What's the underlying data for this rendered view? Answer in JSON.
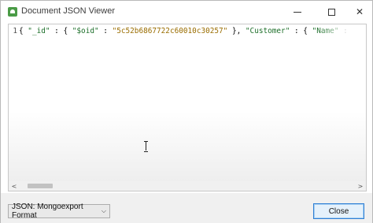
{
  "window": {
    "title": "Document JSON Viewer",
    "controls": {
      "minimize_icon": "minimize-icon",
      "maximize_icon": "maximize-icon",
      "close_glyph": "✕"
    }
  },
  "editor": {
    "line_number": "1",
    "tokens": [
      {
        "t": "{ ",
        "c": "punc"
      },
      {
        "t": "\"_id\"",
        "c": "key"
      },
      {
        "t": " : { ",
        "c": "punc"
      },
      {
        "t": "\"$oid\"",
        "c": "key"
      },
      {
        "t": " : ",
        "c": "punc"
      },
      {
        "t": "\"5c52b6867722c60010c30257\"",
        "c": "str"
      },
      {
        "t": " }, ",
        "c": "punc"
      },
      {
        "t": "\"Customer\"",
        "c": "key"
      },
      {
        "t": " : { ",
        "c": "punc"
      },
      {
        "t": "\"Name\"",
        "c": "key"
      },
      {
        "t": " : ",
        "c": "punc"
      },
      {
        "t": "\"",
        "c": "str"
      }
    ]
  },
  "scrollbar": {
    "left_arrow": "<",
    "right_arrow": ">"
  },
  "footer": {
    "format_selected": "JSON: Mongoexport Format",
    "format_chevron": "⌵",
    "close_label": "Close"
  }
}
